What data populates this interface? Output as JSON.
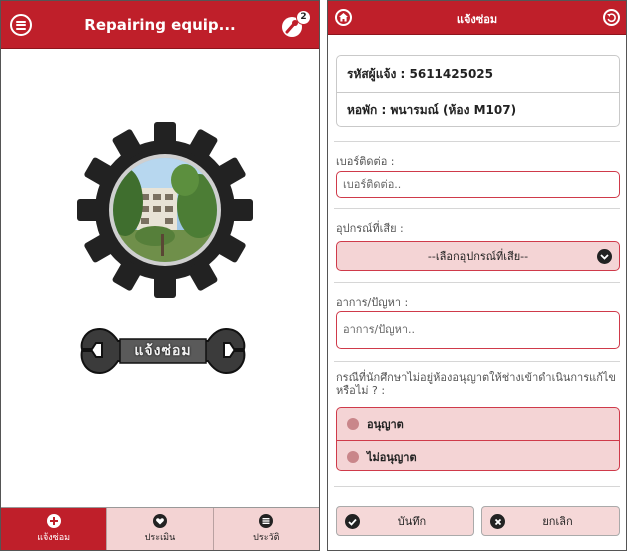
{
  "left_screen": {
    "header": {
      "title": "Repairing equip...",
      "notification_count": "2"
    },
    "logo": {
      "icon": "gear-building-photo-icon"
    },
    "repair_button": {
      "label": "แจ้งซ่อม",
      "icon": "wrench-icon"
    },
    "tabs": [
      {
        "label": "แจ้งซ่อม",
        "icon": "plus-circle-icon",
        "active": true
      },
      {
        "label": "ประเมิน",
        "icon": "heart-icon",
        "active": false
      },
      {
        "label": "ประวัติ",
        "icon": "list-icon",
        "active": false
      }
    ]
  },
  "right_screen": {
    "header": {
      "title": "แจ้งซ่อม",
      "home_icon": "home-icon",
      "back_icon": "back-icon"
    },
    "info": {
      "reporter_id": "รหัสผู้แจ้ง : 5611425025",
      "dormitory": "หอพัก : พนารมณ์ (ห้อง M107)"
    },
    "phone": {
      "label": "เบอร์ติดต่อ :",
      "placeholder": "เบอร์ติดต่อ.."
    },
    "equipment": {
      "label": "อุปกรณ์ที่เสีย :",
      "selected": "--เลือกอุปกรณ์ที่เสีย--"
    },
    "symptom": {
      "label": "อาการ/ปัญหา :",
      "placeholder": "อาการ/ปัญหา.."
    },
    "permission": {
      "question": "กรณีที่นักศึกษาไม่อยู่ห้องอนุญาตให้ช่างเข้าดำเนินการแก้ไขหรือไม่ ? :",
      "options": [
        "อนุญาต",
        "ไม่อนุญาต"
      ]
    },
    "buttons": {
      "save": "บันทึก",
      "cancel": "ยกเลิก"
    }
  },
  "colors": {
    "primary": "#bf1f2a",
    "accent_light": "#f4d4d5",
    "border_red": "#cf3a4a"
  }
}
